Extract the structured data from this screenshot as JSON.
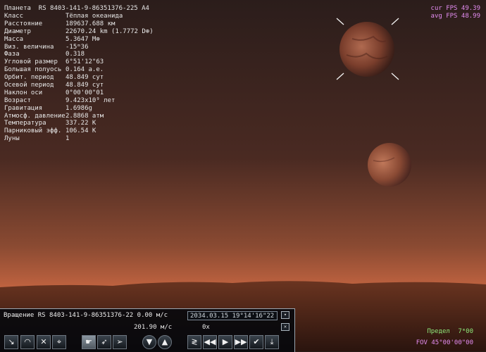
{
  "info": {
    "title_label": "Планета",
    "title_value": "RS 8403-141-9-86351376-225 A4",
    "rows": [
      {
        "k": "Класс",
        "v": "Тёплая океанида"
      },
      {
        "k": "Расстояние",
        "v": "189637.688 км"
      },
      {
        "k": "Диаметр",
        "v": "22670.24 km (1.7772 D⊕)"
      },
      {
        "k": "Масса",
        "v": "5.3647 M⊕"
      },
      {
        "k": "Виз. величина",
        "v": "-15ᵐ36"
      },
      {
        "k": "Фаза",
        "v": "0.318"
      },
      {
        "k": "Угловой размер",
        "v": "6°51'12\"63"
      },
      {
        "k": "Большая полуось",
        "v": "0.164 а.е."
      },
      {
        "k": "Орбит. период",
        "v": "48.849 сут"
      },
      {
        "k": "Осевой период",
        "v": "48.849 сут"
      },
      {
        "k": "Наклон оси",
        "v": "0°00'00\"01"
      },
      {
        "k": "Возраст",
        "v": "9.423x10⁹ лет"
      },
      {
        "k": "Гравитация",
        "v": "1.6986g"
      },
      {
        "k": "Атмосф. давление",
        "v": "2.8868 атм"
      },
      {
        "k": "Температура",
        "v": "337.22 K"
      },
      {
        "k": "Парниковый эфф.",
        "v": "106.54 K"
      },
      {
        "k": "Луны",
        "v": "1"
      }
    ]
  },
  "fps": {
    "cur_label": "cur FPS",
    "cur_value": "49.39",
    "avg_label": "avg FPS",
    "avg_value": "48.99"
  },
  "panel": {
    "object_text": "Вращение RS 8403-141-9-86351376-22 0.00 м/с",
    "speed_text": "201.90 м/с",
    "date_value": "2034.03.15 19°14'16\"22",
    "rate_text": "0x",
    "scroll_down_icon": "chevron-down-icon",
    "close_icon": "close-icon"
  },
  "toolbar": {
    "icons": [
      "move-icon",
      "orbit-icon",
      "expand-icon",
      "target-icon",
      "hand-pointer-icon",
      "rocket-icon",
      "fly-icon",
      "arrow-down-circle-icon",
      "arrow-up-circle-icon",
      "reverse-time-icon",
      "fast-rewind-icon",
      "play-icon",
      "fast-forward-icon",
      "check-icon",
      "download-arrow-icon"
    ]
  },
  "status": {
    "limit_label": "Предел",
    "limit_value": "7ᵐ00",
    "fov_label": "FOV",
    "fov_value": "45°00'00\"00"
  },
  "colors": {
    "sky_top": "#2b1d1b",
    "sky_horizon": "#c06340",
    "ground": "#3a1e14",
    "fps_text": "#e28cf0",
    "limit_text": "#8ee97a"
  }
}
